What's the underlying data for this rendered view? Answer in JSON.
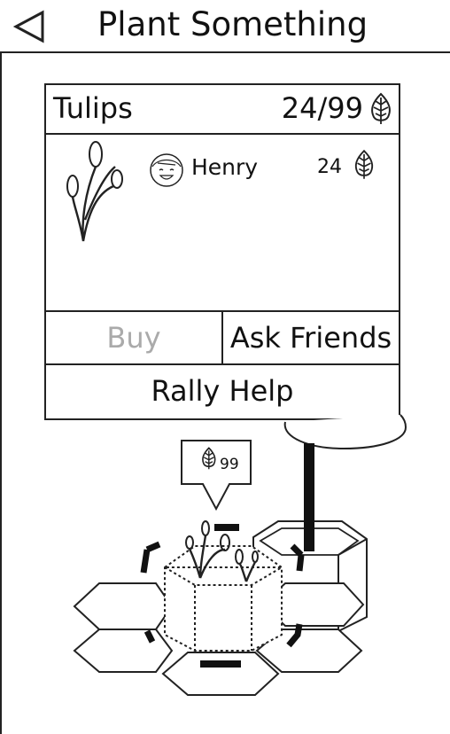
{
  "header": {
    "title": "Plant Something",
    "back_icon": "back-arrow-icon"
  },
  "card": {
    "plant_name": "Tulips",
    "progress_text": "24/99",
    "progress": {
      "current": 24,
      "goal": 99
    },
    "currency_icon": "leaf-icon",
    "contributor": {
      "avatar_icon": "smiley-avatar-icon",
      "name": "Henry",
      "amount": "24"
    },
    "buttons": {
      "buy": "Buy",
      "ask_friends": "Ask Friends",
      "rally_help": "Rally Help"
    },
    "buy_color": "#aaaaaa"
  },
  "scene": {
    "bubble_value": "99",
    "plot_icon": "hex-tile-icon",
    "pot_icon": "hex-pot-icon"
  }
}
